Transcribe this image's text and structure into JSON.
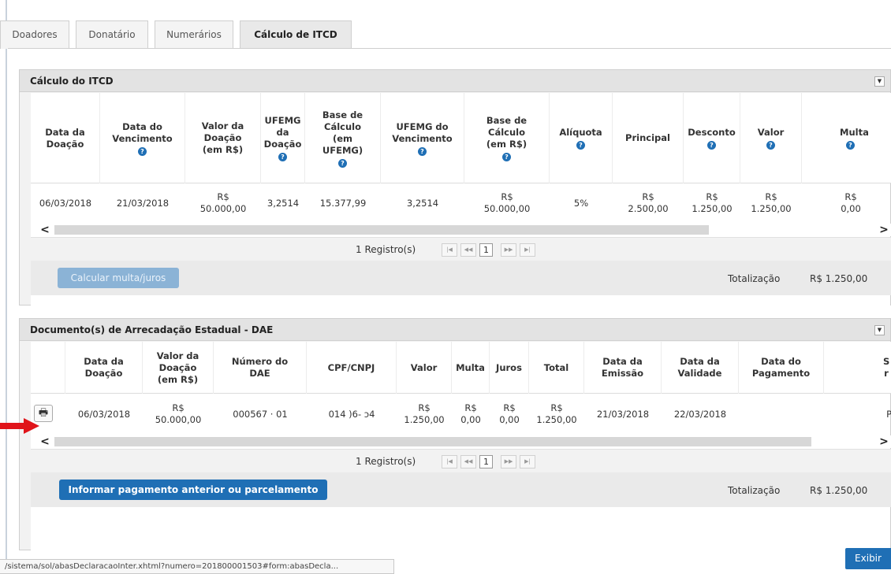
{
  "tabs": [
    {
      "label": "Doadores"
    },
    {
      "label": "Donatário"
    },
    {
      "label": "Numerários"
    },
    {
      "label": "Cálculo de ITCD"
    }
  ],
  "calc_panel": {
    "title": "Cálculo do ITCD",
    "columns": [
      {
        "label": "Data da Doação",
        "help": false
      },
      {
        "label": "Data do Vencimento",
        "help": true
      },
      {
        "label": "Valor da Doação (em R$)",
        "help": false
      },
      {
        "label": "UFEMG da Doação",
        "help": true
      },
      {
        "label": "Base de Cálculo (em UFEMG)",
        "help": true
      },
      {
        "label": "UFEMG do Vencimento",
        "help": true
      },
      {
        "label": "Base de Cálculo (em R$)",
        "help": true
      },
      {
        "label": "Alíquota",
        "help": true
      },
      {
        "label": "Principal",
        "help": false
      },
      {
        "label": "Desconto",
        "help": true
      },
      {
        "label": "Valor",
        "help": true
      },
      {
        "label": "Multa",
        "help": true
      }
    ],
    "row": [
      "06/03/2018",
      "21/03/2018",
      "R$ 50.000,00",
      "3,2514",
      "15.377,99",
      "3,2514",
      "R$ 50.000,00",
      "5%",
      "R$ 2.500,00",
      "R$ 1.250,00",
      "R$ 1.250,00",
      "R$ 0,00"
    ],
    "pager_count": "1 Registro(s)",
    "current_page": "1",
    "button_label": "Calcular multa/juros",
    "total_label": "Totalização",
    "total_value": "R$ 1.250,00"
  },
  "dae_panel": {
    "title": "Documento(s) de Arrecadação Estadual - DAE",
    "columns": [
      {
        "label": "Data da Doação"
      },
      {
        "label": "Valor da Doação (em R$)"
      },
      {
        "label": "Número do DAE"
      },
      {
        "label": "CPF/CNPJ"
      },
      {
        "label": "Valor"
      },
      {
        "label": "Multa"
      },
      {
        "label": "Juros"
      },
      {
        "label": "Total"
      },
      {
        "label": "Data da Emissão"
      },
      {
        "label": "Data da Validade"
      },
      {
        "label": "Data do Pagamento"
      },
      {
        "label": "S r"
      }
    ],
    "row": [
      "06/03/2018",
      "R$ 50.000,00",
      "000567 · 01",
      "014 )6- ɔ4",
      "R$ 1.250,00",
      "R$ 0,00",
      "R$ 0,00",
      "R$ 1.250,00",
      "21/03/2018",
      "22/03/2018",
      "",
      "P"
    ],
    "pager_count": "1 Registro(s)",
    "current_page": "1",
    "button_label": "Informar pagamento anterior ou parcelamento",
    "total_label": "Totalização",
    "total_value": "R$ 1.250,00"
  },
  "status_url": "/sistema/sol/abasDeclaracaoInter.xhtml?numero=201800001503#form:abasDecla...",
  "exibir_label": "Exibir",
  "colors": {
    "accent": "#1f6fb5",
    "arrow": "#e0141a"
  }
}
